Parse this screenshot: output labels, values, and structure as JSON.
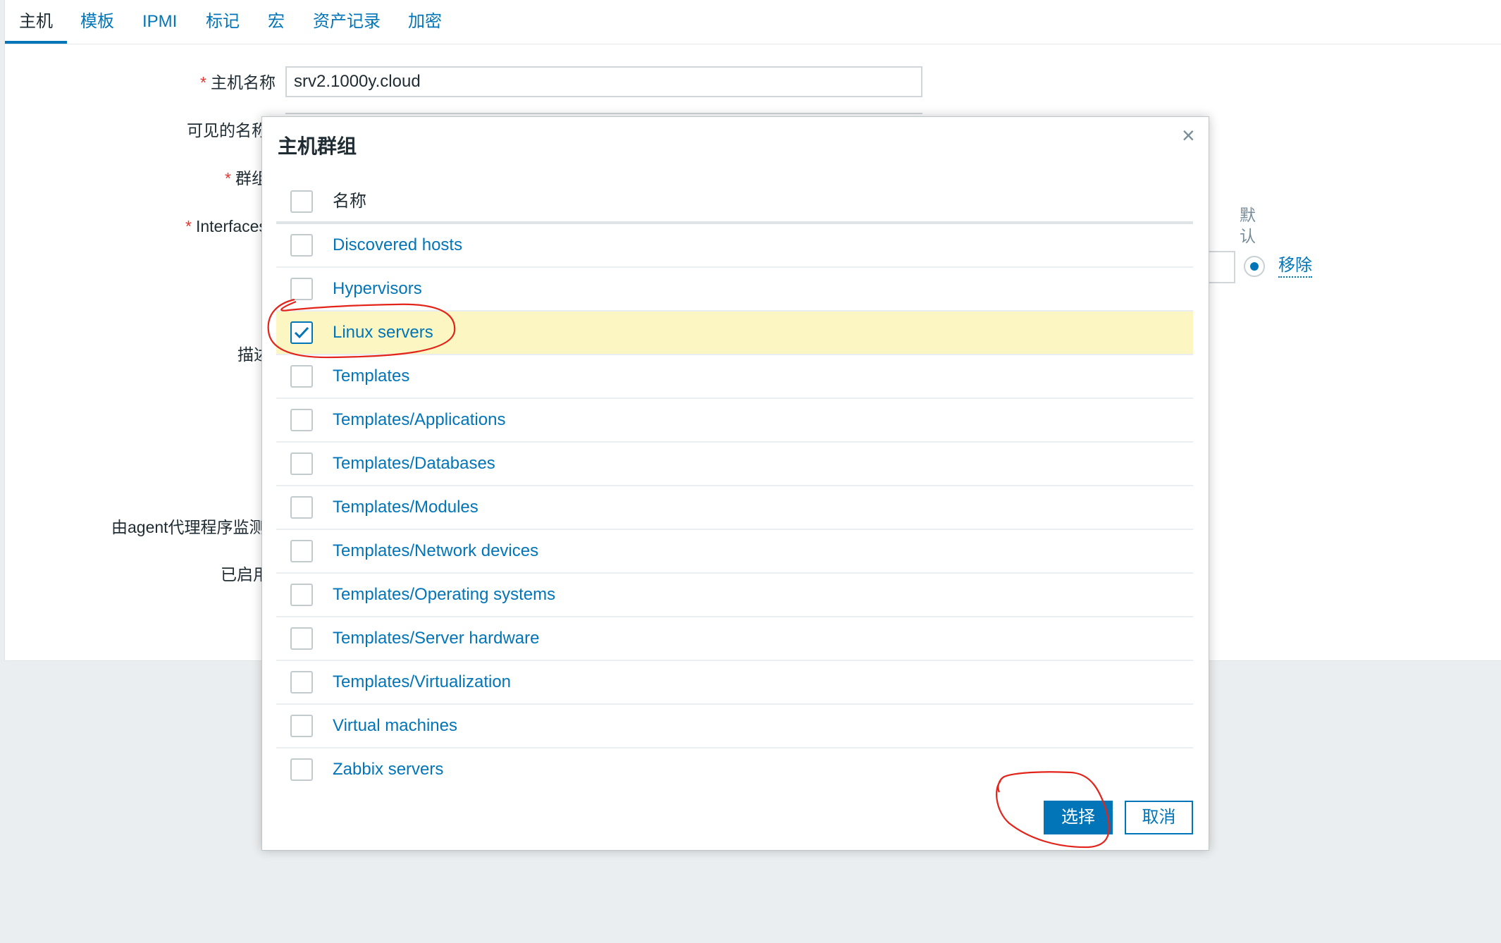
{
  "tabs": [
    {
      "label": "主机"
    },
    {
      "label": "模板"
    },
    {
      "label": "IPMI"
    },
    {
      "label": "标记"
    },
    {
      "label": "宏"
    },
    {
      "label": "资产记录"
    },
    {
      "label": "加密"
    }
  ],
  "form": {
    "host_name_label": "主机名称",
    "host_name_value": "srv2.1000y.cloud",
    "visible_name_label": "可见的名称",
    "groups_label": "群组",
    "interfaces_label": "Interfaces",
    "description_label": "描述",
    "proxy_label": "由agent代理程序监测",
    "enabled_label": "已启用",
    "required_mark": "*",
    "default_col": "默认",
    "remove_link": "移除"
  },
  "modal": {
    "title": "主机群组",
    "close": "×",
    "column_name": "名称",
    "rows": [
      {
        "name": "Discovered hosts",
        "checked": false
      },
      {
        "name": "Hypervisors",
        "checked": false
      },
      {
        "name": "Linux servers",
        "checked": true
      },
      {
        "name": "Templates",
        "checked": false
      },
      {
        "name": "Templates/Applications",
        "checked": false
      },
      {
        "name": "Templates/Databases",
        "checked": false
      },
      {
        "name": "Templates/Modules",
        "checked": false
      },
      {
        "name": "Templates/Network devices",
        "checked": false
      },
      {
        "name": "Templates/Operating systems",
        "checked": false
      },
      {
        "name": "Templates/Server hardware",
        "checked": false
      },
      {
        "name": "Templates/Virtualization",
        "checked": false
      },
      {
        "name": "Virtual machines",
        "checked": false
      },
      {
        "name": "Zabbix servers",
        "checked": false
      }
    ],
    "select_button": "选择",
    "cancel_button": "取消"
  },
  "colors": {
    "accent": "#0275b8",
    "selected_row": "#fcf7c2",
    "required": "#e33734",
    "annotation": "#e3241b"
  }
}
